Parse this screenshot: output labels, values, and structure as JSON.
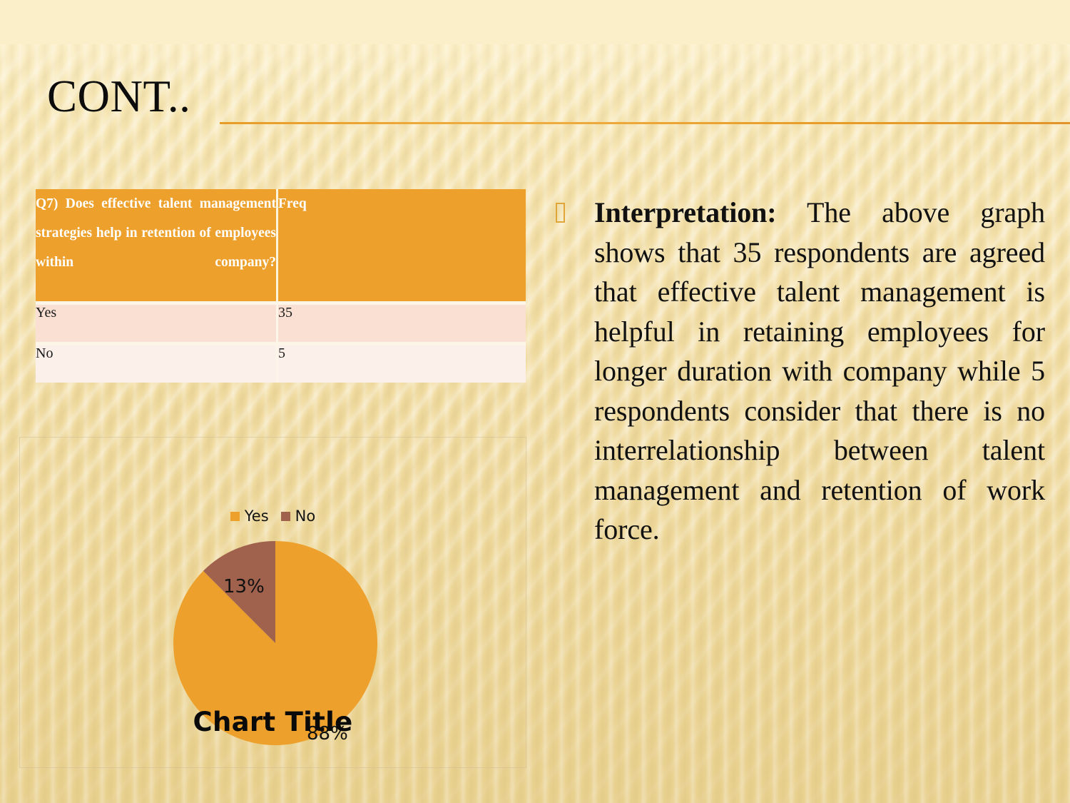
{
  "slide": {
    "title": "CONT..",
    "background_color": "#f5e2ac",
    "accent_color": "#eda12c"
  },
  "table": {
    "headers": [
      "Q7)  Does  effective  talent  management  strategies  help  in  retention  of  employees  within  company?",
      "Freq"
    ],
    "rows": [
      {
        "label": "Yes",
        "freq": "35"
      },
      {
        "label": "No",
        "freq": "5"
      }
    ],
    "header_bg": "#eda12c",
    "row_bg_1": "#f9e0d2",
    "row_bg_2": "#fbf0ea"
  },
  "chart_data": {
    "type": "pie",
    "title": "Chart Title",
    "categories": [
      "Yes",
      "No"
    ],
    "values": [
      35,
      5
    ],
    "percent_labels": [
      "88%",
      "13%"
    ],
    "colors": [
      "#eda12c",
      "#a0614d"
    ],
    "legend": {
      "position": "top",
      "entries": [
        {
          "label": "Yes",
          "color": "#eda12c"
        },
        {
          "label": "No",
          "color": "#a0614d"
        }
      ]
    },
    "start_angle_deg": 0,
    "direction": "clockwise",
    "grid": false,
    "xlabel": "",
    "ylabel": ""
  },
  "interpretation": {
    "bullet_icon": "hollow-square-bullet",
    "lead": "Interpretation:",
    "body": " The above graph shows that 35 respondents are agreed that effective talent management is helpful in retaining employees for longer duration with company while 5 respondents consider that there is no interrelationship between talent management and retention of work force."
  }
}
